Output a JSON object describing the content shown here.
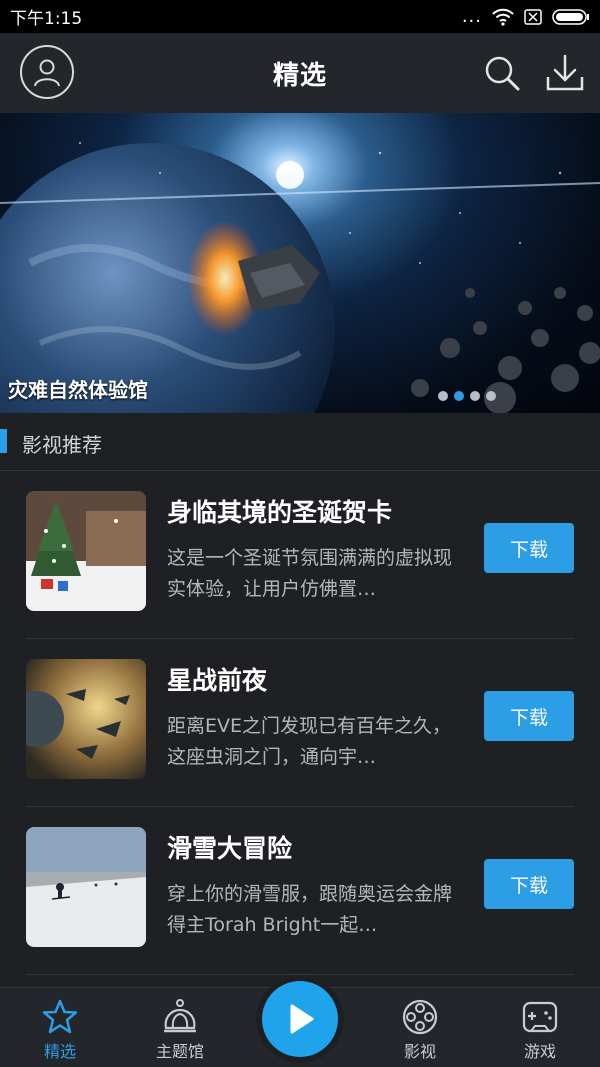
{
  "status": {
    "time": "下午1:15",
    "dots": "..."
  },
  "header": {
    "title": "精选"
  },
  "banner": {
    "caption": "灾难自然体验馆",
    "slide_count": 4,
    "active_slide": 2
  },
  "section": {
    "title": "影视推荐"
  },
  "items": [
    {
      "title": "身临其境的圣诞贺卡",
      "desc": "这是一个圣诞节氛围满满的虚拟现实体验，让用户仿佛置…",
      "button": "下载",
      "thumb_icon": "christmas-scene-thumbnail"
    },
    {
      "title": "星战前夜",
      "desc": "距离EVE之门发现已有百年之久，这座虫洞之门，通向宇…",
      "button": "下载",
      "thumb_icon": "space-battle-thumbnail"
    },
    {
      "title": "滑雪大冒险",
      "desc": "穿上你的滑雪服，跟随奥运会金牌得主Torah Bright一起…",
      "button": "下载",
      "thumb_icon": "ski-slope-thumbnail"
    }
  ],
  "tabs": [
    {
      "label": "精选",
      "icon": "star-icon",
      "active": true
    },
    {
      "label": "主题馆",
      "icon": "crown-icon",
      "active": false
    },
    {
      "label": "影视",
      "icon": "film-reel-icon",
      "active": false
    },
    {
      "label": "游戏",
      "icon": "gamepad-icon",
      "active": false
    }
  ],
  "colors": {
    "accent": "#2c9ee6",
    "background": "#1e2024",
    "bar": "#23262b"
  }
}
